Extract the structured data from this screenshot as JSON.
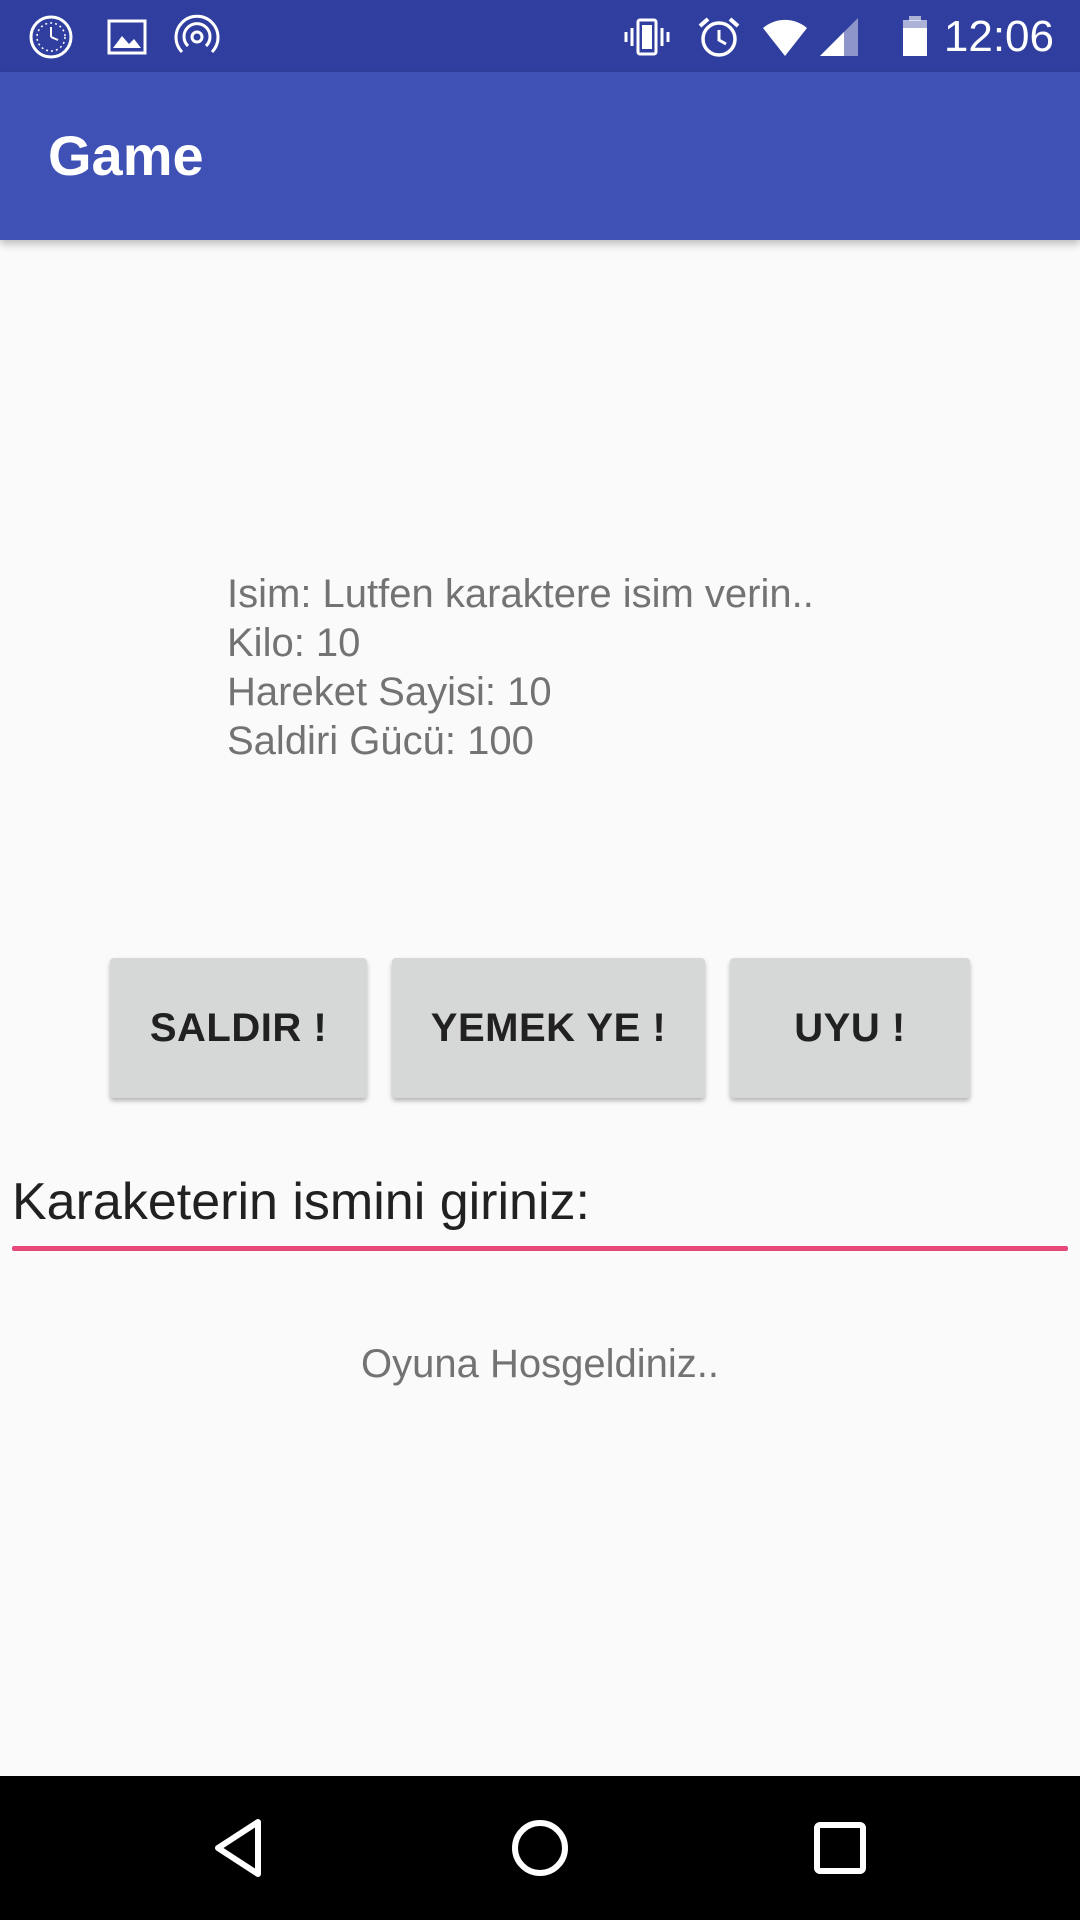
{
  "status_bar": {
    "time": "12:06",
    "left_icons": [
      "clock-app-icon",
      "image-icon",
      "hotspot-icon"
    ],
    "right_icons": [
      "vibrate-icon",
      "alarm-icon",
      "wifi-icon",
      "cell-signal-icon",
      "battery-icon"
    ]
  },
  "app_bar": {
    "title": "Game"
  },
  "character_info": {
    "name_line": "Isim: Lutfen karaktere isim verin..",
    "weight_line": "Kilo: 10",
    "moves_line": "Hareket Sayisi: 10",
    "attack_line": "Saldiri Gücü: 100"
  },
  "actions": {
    "attack": "SALDIR !",
    "eat": "YEMEK YE !",
    "sleep": "UYU !"
  },
  "name_input": {
    "placeholder": "Karaketerin ismini giriniz:",
    "value": ""
  },
  "welcome_message": "Oyuna Hosgeldiniz..",
  "nav_bar": {
    "icons": [
      "back-icon",
      "home-icon",
      "recents-icon"
    ]
  },
  "colors": {
    "status_bar": "#303f9f",
    "app_bar": "#3f51b5",
    "accent": "#e8477a",
    "button": "#d6d7d7",
    "background": "#fafafa"
  }
}
